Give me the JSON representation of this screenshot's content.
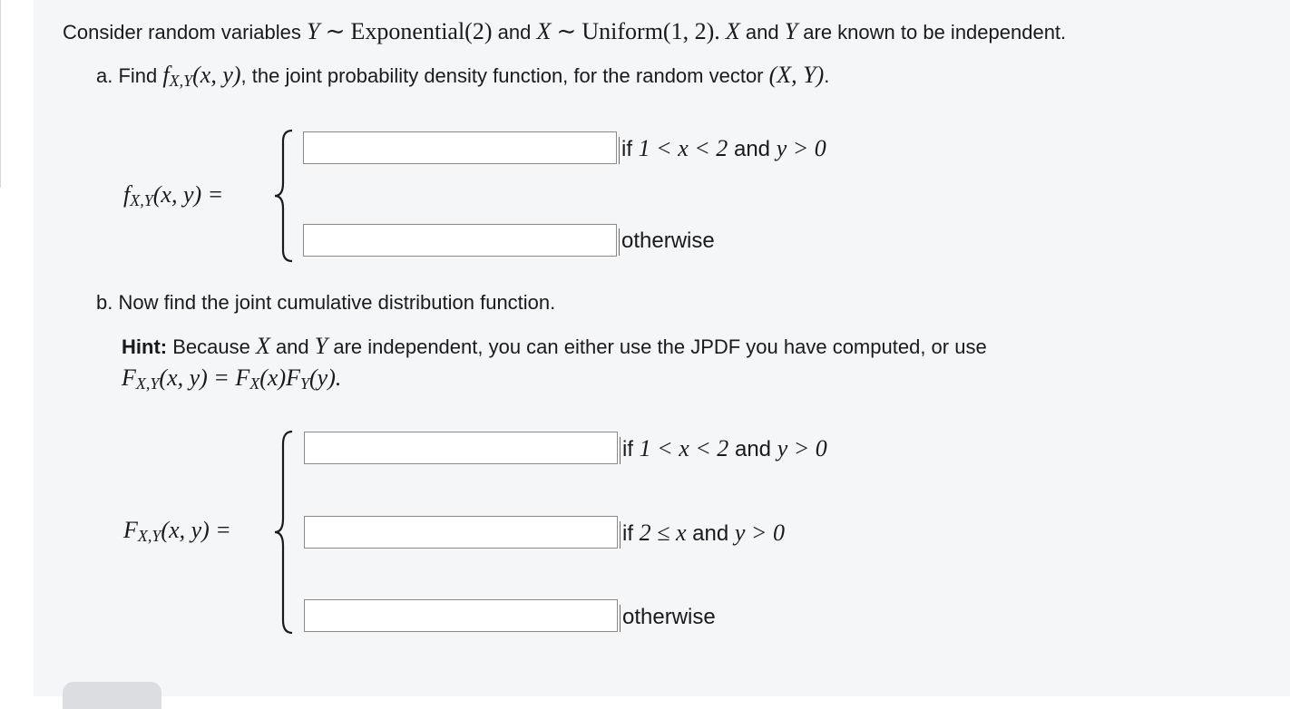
{
  "intro": {
    "t1": "Consider random variables ",
    "Y": "Y",
    "sim1": "∼",
    "exp_dist": "Exponential(2)",
    "and1": " and ",
    "X": "X",
    "sim2": "∼",
    "uni_dist": "Uniform(1, 2).",
    "X2": "X",
    "and2": " and ",
    "Y2": "Y",
    "t2": " are known to be independent."
  },
  "part_a": {
    "prefix": "a. Find ",
    "f": "f",
    "sub": "X,Y",
    "args": "(x, y)",
    "rest": ", the joint probability density function, for the random vector ",
    "vec": "(X, Y)",
    "period": ".",
    "lhs_f": "f",
    "lhs_sub": "X,Y",
    "lhs_args": "(x, y) =",
    "cases": [
      {
        "value": "",
        "cond_if": "if ",
        "cond_math1": "1 < x < 2",
        "cond_and": " and ",
        "cond_math2": "y > 0"
      },
      {
        "value": "",
        "cond_text": "otherwise"
      }
    ]
  },
  "part_b": {
    "heading": "b. Now find the joint cumulative distribution function.",
    "hint_label": "Hint:",
    "hint_t1": " Because ",
    "hint_X": "X",
    "hint_and": " and ",
    "hint_Y": "Y",
    "hint_t2": " are independent, you can either use the JPDF you have computed, or use",
    "formula_F1": "F",
    "formula_sub1": "X,Y",
    "formula_args1": "(x, y) = ",
    "formula_F2": "F",
    "formula_sub2": "X",
    "formula_args2": "(x)",
    "formula_F3": "F",
    "formula_sub3": "Y",
    "formula_args3": "(y).",
    "lhs_F": "F",
    "lhs_sub": "X,Y",
    "lhs_args": "(x, y) =",
    "cases": [
      {
        "value": "",
        "cond_if": "if ",
        "cond_math1": "1 < x < 2",
        "cond_and": " and ",
        "cond_math2": "y > 0"
      },
      {
        "value": "",
        "cond_if": "if ",
        "cond_math1": "2 ≤ x",
        "cond_and": " and ",
        "cond_math2": "y > 0"
      },
      {
        "value": "",
        "cond_text": "otherwise"
      }
    ]
  },
  "colors": {
    "panel_bg": "#f5f6f8",
    "input_border": "#8a8a8a",
    "text": "#1a1a1a"
  }
}
